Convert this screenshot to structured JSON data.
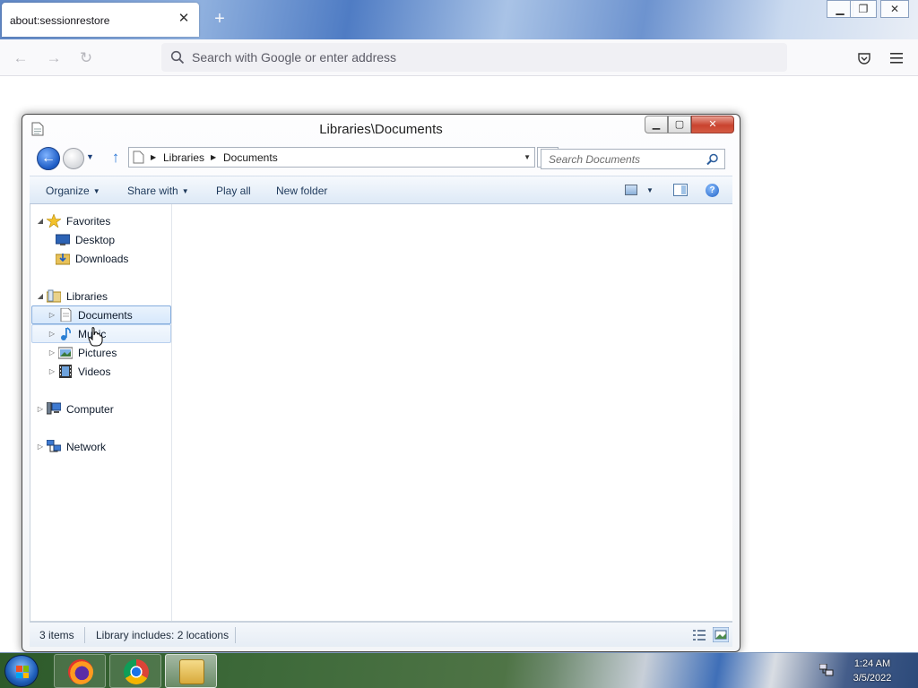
{
  "browser": {
    "tab_title": "about:sessionrestore",
    "tab_close": "✕",
    "new_tab": "+",
    "window_buttons": {
      "minimize": "▁",
      "restore": "❐",
      "close": "✕"
    },
    "nav": {
      "back": "←",
      "forward": "→",
      "reload": "↻"
    },
    "url_placeholder": "Search with Google or enter address",
    "icons": [
      "search-icon",
      "pocket-icon",
      "menu-icon"
    ]
  },
  "explorer": {
    "title": "Libraries\\Documents",
    "caption_buttons": {
      "minimize": "▁",
      "maximize": "▢",
      "close": "✕"
    },
    "breadcrumb": [
      {
        "label": "Libraries"
      },
      {
        "label": "Documents"
      }
    ],
    "search_placeholder": "Search Documents",
    "commands": {
      "organize": "Organize",
      "share_with": "Share with",
      "play_all": "Play all",
      "new_folder": "New folder"
    },
    "help": "?",
    "nav_tree": {
      "favorites": {
        "label": "Favorites",
        "items": [
          {
            "label": "Desktop",
            "icon": "desktop-icon"
          },
          {
            "label": "Downloads",
            "icon": "downloads-folder-icon"
          }
        ]
      },
      "libraries": {
        "label": "Libraries",
        "items": [
          {
            "label": "Documents",
            "icon": "documents-library-icon",
            "selected": true
          },
          {
            "label": "Music",
            "icon": "music-library-icon",
            "hover": true
          },
          {
            "label": "Pictures",
            "icon": "pictures-library-icon"
          },
          {
            "label": "Videos",
            "icon": "videos-library-icon"
          }
        ]
      },
      "computer": {
        "label": "Computer",
        "icon": "computer-icon"
      },
      "network": {
        "label": "Network",
        "icon": "network-icon"
      }
    },
    "status": {
      "items_count": "3 items",
      "library_info": "Library includes: 2 locations"
    }
  },
  "taskbar": {
    "pinned": [
      "firefox-icon",
      "chrome-icon",
      "file-explorer-icon"
    ],
    "active": "file-explorer-icon",
    "clock_time": "1:24 AM",
    "clock_date": "3/5/2022"
  },
  "colors": {
    "explorer_accent": "#1e395b",
    "selection": "#d7e8fb",
    "close_red": "#c9432f"
  }
}
